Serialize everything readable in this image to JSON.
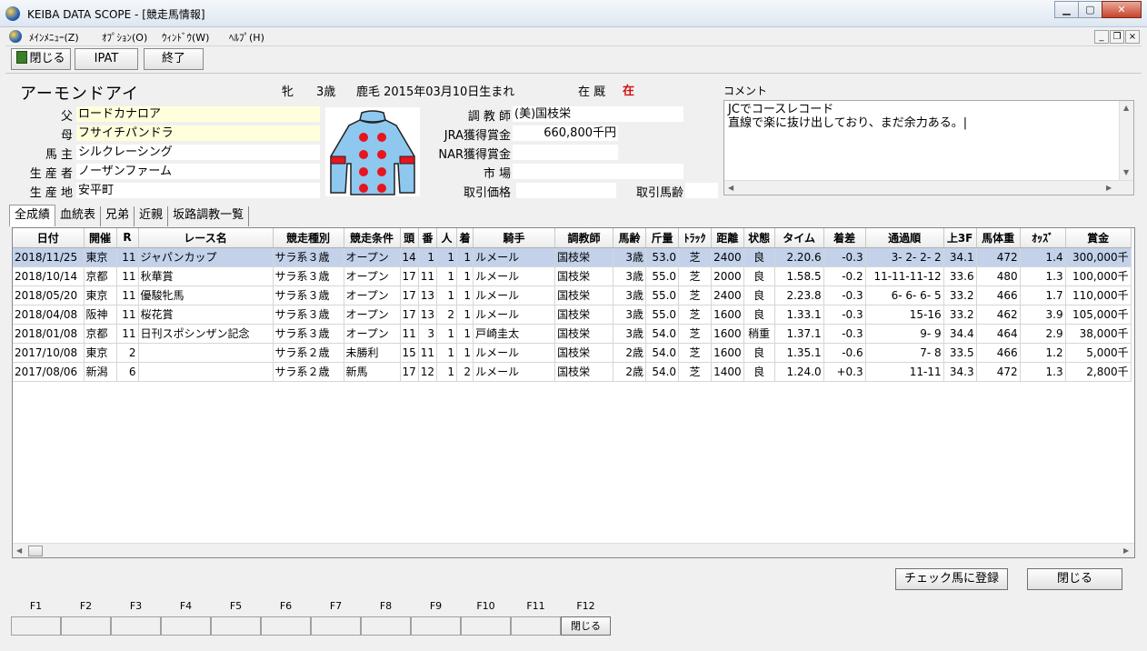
{
  "window": {
    "title": "KEIBA DATA SCOPE - [競走馬情報]"
  },
  "menu": [
    "ﾒｲﾝﾒﾆｭｰ(Z)",
    "ｵﾌﾟｼｮﾝ(O)",
    "ｳｨﾝﾄﾞｳ(W)",
    "ﾍﾙﾌﾟ(H)"
  ],
  "toolbar": {
    "close_label": "閉じる",
    "ipat_label": "IPAT",
    "exit_label": "終了"
  },
  "horse": {
    "name": "アーモンドアイ",
    "sex": "牝",
    "age": "3歳",
    "coat_birth": "鹿毛 2015年03月10日生まれ",
    "stable_label": "在 厩",
    "stable_value": "在",
    "labels": {
      "sire": "父",
      "dam": "母",
      "owner": "馬 主",
      "breeder": "生 産 者",
      "birthplace": "生 産 地",
      "trainer": "調 教 師",
      "jra_prize": "JRA獲得賞金",
      "nar_prize": "NAR獲得賞金",
      "market": "市 場",
      "trade_price": "取引価格",
      "trade_age": "取引馬齢"
    },
    "sire": "ロードカナロア",
    "dam": "フサイチパンドラ",
    "owner": "シルクレーシング",
    "breeder": "ノーザンファーム",
    "birthplace": "安平町",
    "trainer": "(美)国枝栄",
    "jra_prize": "660,800千円",
    "nar_prize": "",
    "market": "",
    "trade_price": "",
    "trade_age": ""
  },
  "comment": {
    "label": "コメント",
    "text": "JCでコースレコード\n直線で楽に抜け出しており、まだ余力ある。|"
  },
  "tabs": [
    "全成績",
    "血統表",
    "兄弟",
    "近親",
    "坂路調教一覧"
  ],
  "table": {
    "columns": [
      "日付",
      "開催",
      "R",
      "レース名",
      "競走種別",
      "競走条件",
      "頭",
      "番",
      "人",
      "着",
      "騎手",
      "調教師",
      "馬齢",
      "斤量",
      "ﾄﾗｯｸ",
      "距離",
      "状態",
      "タイム",
      "着差",
      "通過順",
      "上3F",
      "馬体重",
      "ｵｯｽﾞ",
      "賞金"
    ],
    "rows": [
      [
        "2018/11/25",
        "東京",
        "11",
        "ジャパンカップ",
        "サラ系３歳",
        "オープン",
        "14",
        "1",
        "1",
        "1",
        "ルメール",
        "国枝栄",
        "3歳",
        "53.0",
        "芝",
        "2400",
        "良",
        "2.20.6",
        "-0.3",
        "3- 2- 2- 2",
        "34.1",
        "472",
        "1.4",
        "300,000千"
      ],
      [
        "2018/10/14",
        "京都",
        "11",
        "秋華賞",
        "サラ系３歳",
        "オープン",
        "17",
        "11",
        "1",
        "1",
        "ルメール",
        "国枝栄",
        "3歳",
        "55.0",
        "芝",
        "2000",
        "良",
        "1.58.5",
        "-0.2",
        "11-11-11-12",
        "33.6",
        "480",
        "1.3",
        "100,000千"
      ],
      [
        "2018/05/20",
        "東京",
        "11",
        "優駿牝馬",
        "サラ系３歳",
        "オープン",
        "17",
        "13",
        "1",
        "1",
        "ルメール",
        "国枝栄",
        "3歳",
        "55.0",
        "芝",
        "2400",
        "良",
        "2.23.8",
        "-0.3",
        "6- 6- 6- 5",
        "33.2",
        "466",
        "1.7",
        "110,000千"
      ],
      [
        "2018/04/08",
        "阪神",
        "11",
        "桜花賞",
        "サラ系３歳",
        "オープン",
        "17",
        "13",
        "2",
        "1",
        "ルメール",
        "国枝栄",
        "3歳",
        "55.0",
        "芝",
        "1600",
        "良",
        "1.33.1",
        "-0.3",
        "15-16",
        "33.2",
        "462",
        "3.9",
        "105,000千"
      ],
      [
        "2018/01/08",
        "京都",
        "11",
        "日刊スポシンザン記念",
        "サラ系３歳",
        "オープン",
        "11",
        "3",
        "1",
        "1",
        "戸崎圭太",
        "国枝栄",
        "3歳",
        "54.0",
        "芝",
        "1600",
        "稍重",
        "1.37.1",
        "-0.3",
        "9- 9",
        "34.4",
        "464",
        "2.9",
        "38,000千"
      ],
      [
        "2017/10/08",
        "東京",
        "2",
        "",
        "サラ系２歳",
        "未勝利",
        "15",
        "11",
        "1",
        "1",
        "ルメール",
        "国枝栄",
        "2歳",
        "54.0",
        "芝",
        "1600",
        "良",
        "1.35.1",
        "-0.6",
        "7- 8",
        "33.5",
        "466",
        "1.2",
        "5,000千"
      ],
      [
        "2017/08/06",
        "新潟",
        "6",
        "",
        "サラ系２歳",
        "新馬",
        "17",
        "12",
        "1",
        "2",
        "ルメール",
        "国枝栄",
        "2歳",
        "54.0",
        "芝",
        "1400",
        "良",
        "1.24.0",
        "+0.3",
        "11-11",
        "34.3",
        "472",
        "1.3",
        "2,800千"
      ]
    ]
  },
  "buttons": {
    "register": "チェック馬に登録",
    "close": "閉じる"
  },
  "fkeys": [
    {
      "key": "F1",
      "label": ""
    },
    {
      "key": "F2",
      "label": ""
    },
    {
      "key": "F3",
      "label": ""
    },
    {
      "key": "F4",
      "label": ""
    },
    {
      "key": "F5",
      "label": ""
    },
    {
      "key": "F6",
      "label": ""
    },
    {
      "key": "F7",
      "label": ""
    },
    {
      "key": "F8",
      "label": ""
    },
    {
      "key": "F9",
      "label": ""
    },
    {
      "key": "F10",
      "label": ""
    },
    {
      "key": "F11",
      "label": ""
    },
    {
      "key": "F12",
      "label": "閉じる"
    }
  ],
  "colors": {
    "selected_row": "#c3d2ea",
    "field_yellow": "#ffffdc",
    "silks_body": "#8ec8ef",
    "silks_dots": "#e8141e",
    "stable_red": "#d01010"
  },
  "icons": [
    "app-icon",
    "close-icon",
    "maximize-icon",
    "minimize-icon",
    "door-icon",
    "jockey-silks-icon"
  ]
}
